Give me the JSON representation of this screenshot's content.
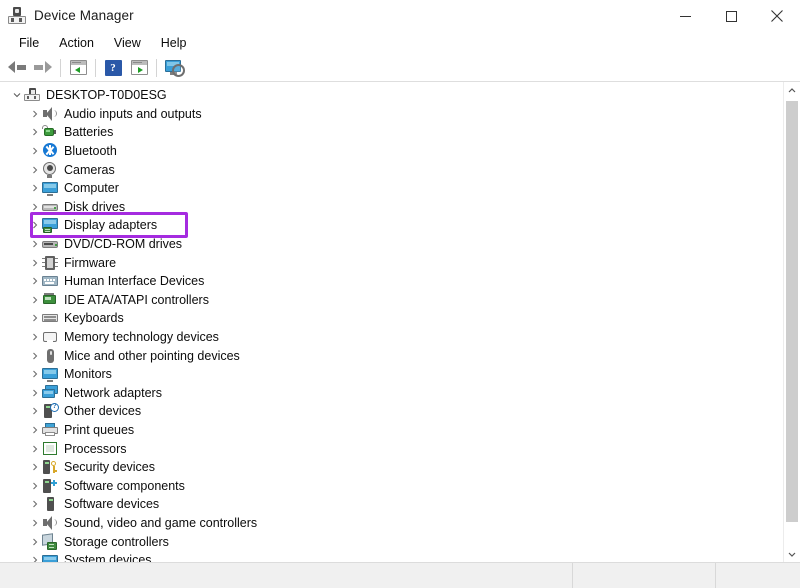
{
  "window": {
    "title": "Device Manager",
    "icon": "device-manager-icon",
    "controls": {
      "minimize": "minimize-icon",
      "maximize": "maximize-icon",
      "close": "close-icon"
    }
  },
  "menubar": {
    "items": [
      {
        "label": "File"
      },
      {
        "label": "Action"
      },
      {
        "label": "View"
      },
      {
        "label": "Help"
      }
    ]
  },
  "toolbar": {
    "buttons": [
      {
        "name": "back-button",
        "icon": "back-arrow-icon"
      },
      {
        "name": "forward-button",
        "icon": "forward-arrow-icon"
      },
      {
        "name": "show-hide-console-tree-button",
        "icon": "console-tree-icon"
      },
      {
        "name": "help-button",
        "icon": "question-mark-icon"
      },
      {
        "name": "properties-button",
        "icon": "properties-window-icon"
      },
      {
        "name": "scan-for-hardware-changes-button",
        "icon": "scan-hardware-icon"
      }
    ]
  },
  "tree": {
    "root": {
      "label": "DESKTOP-T0D0ESG",
      "icon": "computer-icon",
      "expander": "chevron-down-icon",
      "expanded": true
    },
    "items": [
      {
        "label": "Audio inputs and outputs",
        "icon": "speaker-icon"
      },
      {
        "label": "Batteries",
        "icon": "battery-icon"
      },
      {
        "label": "Bluetooth",
        "icon": "bluetooth-icon"
      },
      {
        "label": "Cameras",
        "icon": "camera-icon"
      },
      {
        "label": "Computer",
        "icon": "monitor-icon"
      },
      {
        "label": "Disk drives",
        "icon": "disk-drive-icon"
      },
      {
        "label": "Display adapters",
        "icon": "display-adapter-icon",
        "highlighted": true
      },
      {
        "label": "DVD/CD-ROM drives",
        "icon": "dvd-drive-icon"
      },
      {
        "label": "Firmware",
        "icon": "firmware-chip-icon"
      },
      {
        "label": "Human Interface Devices",
        "icon": "hid-icon"
      },
      {
        "label": "IDE ATA/ATAPI controllers",
        "icon": "ide-controller-icon"
      },
      {
        "label": "Keyboards",
        "icon": "keyboard-icon"
      },
      {
        "label": "Memory technology devices",
        "icon": "memory-device-icon"
      },
      {
        "label": "Mice and other pointing devices",
        "icon": "mouse-icon"
      },
      {
        "label": "Monitors",
        "icon": "monitor-icon"
      },
      {
        "label": "Network adapters",
        "icon": "network-adapter-icon"
      },
      {
        "label": "Other devices",
        "icon": "unknown-device-icon"
      },
      {
        "label": "Print queues",
        "icon": "printer-icon"
      },
      {
        "label": "Processors",
        "icon": "processor-icon"
      },
      {
        "label": "Security devices",
        "icon": "security-device-icon"
      },
      {
        "label": "Software components",
        "icon": "software-component-icon"
      },
      {
        "label": "Software devices",
        "icon": "software-device-icon"
      },
      {
        "label": "Sound, video and game controllers",
        "icon": "speaker-icon"
      },
      {
        "label": "Storage controllers",
        "icon": "storage-controller-icon"
      },
      {
        "label": "System devices",
        "icon": "system-device-icon"
      }
    ],
    "expander_collapsed": "chevron-right-icon",
    "highlight_color": "#a52be0"
  },
  "scrollbar": {
    "up_arrow": "chevron-up-icon",
    "down_arrow": "chevron-down-icon",
    "thumb": "scrollbar-thumb"
  },
  "statusbar": {
    "cells": [
      "",
      "",
      ""
    ]
  }
}
